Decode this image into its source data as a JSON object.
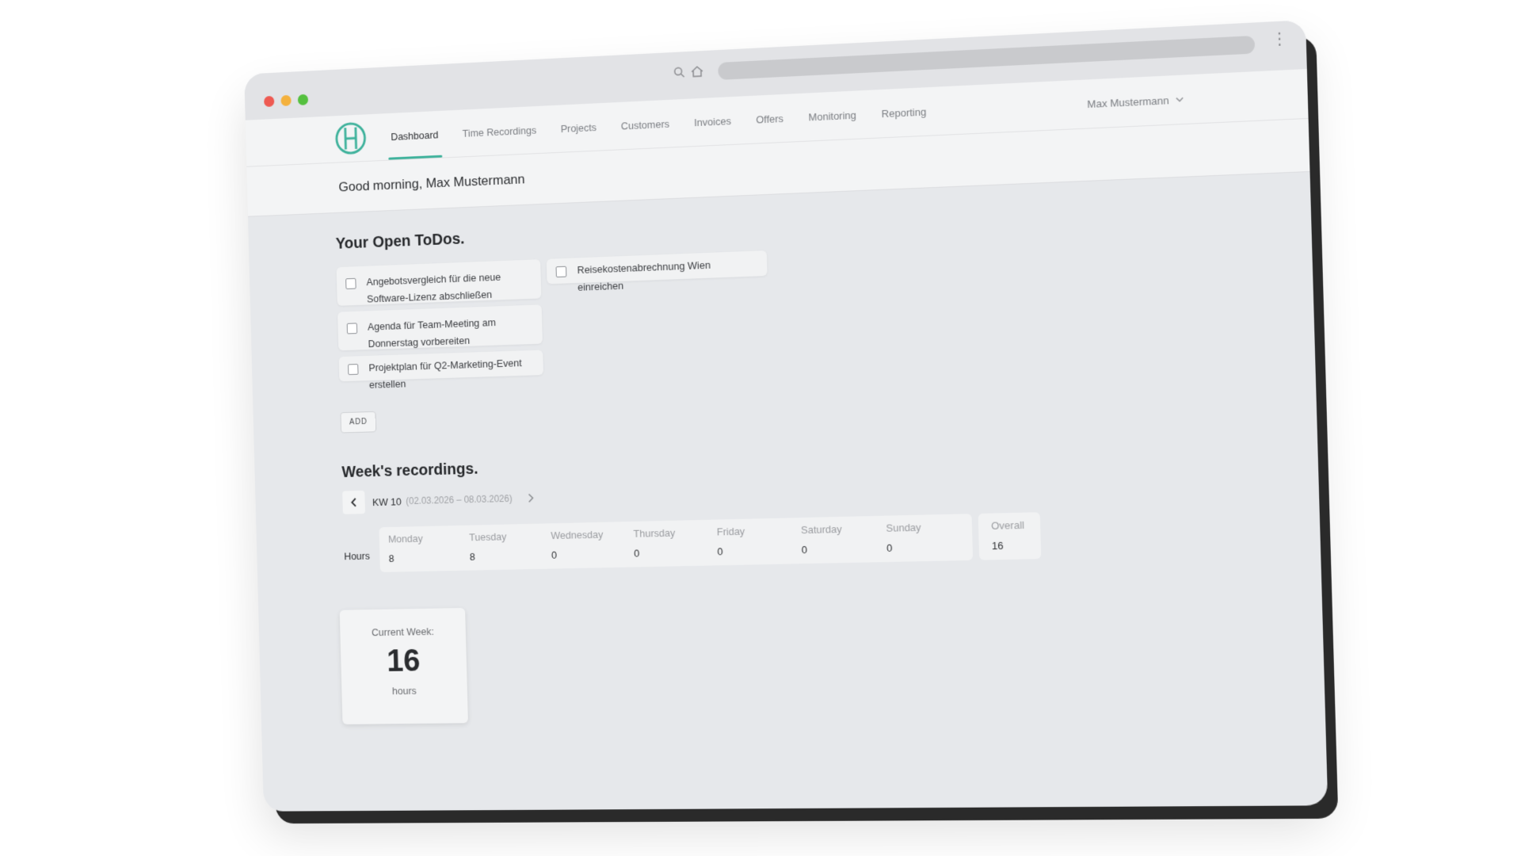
{
  "header": {
    "nav": [
      {
        "label": "Dashboard",
        "active": true
      },
      {
        "label": "Time Recordings",
        "active": false
      },
      {
        "label": "Projects",
        "active": false
      },
      {
        "label": "Customers",
        "active": false
      },
      {
        "label": "Invoices",
        "active": false
      },
      {
        "label": "Offers",
        "active": false
      },
      {
        "label": "Monitoring",
        "active": false
      },
      {
        "label": "Reporting",
        "active": false
      }
    ],
    "user_name": "Max Mustermann"
  },
  "greeting": "Good morning, Max Mustermann",
  "todos": {
    "title": "Your Open ToDos.",
    "items": [
      "Angebotsvergleich für die neue Software-Lizenz abschließen",
      "Reisekostenabrechnung Wien einreichen",
      "Agenda für Team-Meeting am Donnerstag vorbereiten",
      "Projektplan für Q2-Marketing-Event erstellen"
    ],
    "add_label": "ADD"
  },
  "recordings": {
    "title": "Week's recordings.",
    "week_label": "KW 10",
    "week_range": "(02.03.2026 – 08.03.2026)",
    "row_label": "Hours",
    "days": [
      {
        "name": "Monday",
        "value": "8"
      },
      {
        "name": "Tuesday",
        "value": "8"
      },
      {
        "name": "Wednesday",
        "value": "0"
      },
      {
        "name": "Thursday",
        "value": "0"
      },
      {
        "name": "Friday",
        "value": "0"
      },
      {
        "name": "Saturday",
        "value": "0"
      },
      {
        "name": "Sunday",
        "value": "0"
      }
    ],
    "overall": {
      "name": "Overall",
      "value": "16"
    }
  },
  "current_week": {
    "label": "Current Week:",
    "value": "16",
    "unit": "hours"
  },
  "colors": {
    "accent": "#3fb29c",
    "traffic_red": "#ee5a52",
    "traffic_yellow": "#f4b13d",
    "traffic_green": "#55c03f"
  }
}
